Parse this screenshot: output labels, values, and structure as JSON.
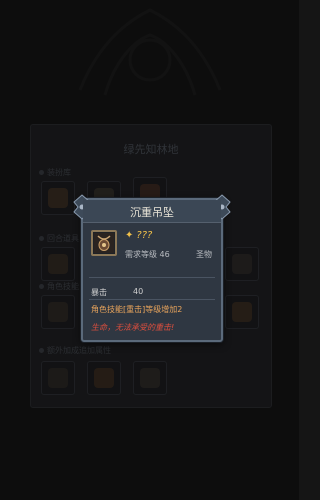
{
  "panel": {
    "title": "绿先知林地",
    "sections": [
      {
        "label": "装扮库"
      },
      {
        "label": "回合道具"
      },
      {
        "label": "角色技能"
      },
      {
        "label": "额外加成追加属性"
      }
    ]
  },
  "tooltip": {
    "title": "沉重吊坠",
    "item_icon": "pendant-icon",
    "name": "???",
    "level_text": "需求等级 46",
    "type_text": "圣物",
    "stat_label": "暴击",
    "stat_value": "40",
    "affix": "角色技能[重击]等级增加2",
    "lore": "生命，无法承受的重击!"
  },
  "colors": {
    "background": "#151515",
    "popup_bg": "#2f3742",
    "popup_border": "#5b6a7b",
    "name_gold": "#f2c14a",
    "affix_orange": "#e8a45c",
    "lore_red": "#e04f3e"
  }
}
